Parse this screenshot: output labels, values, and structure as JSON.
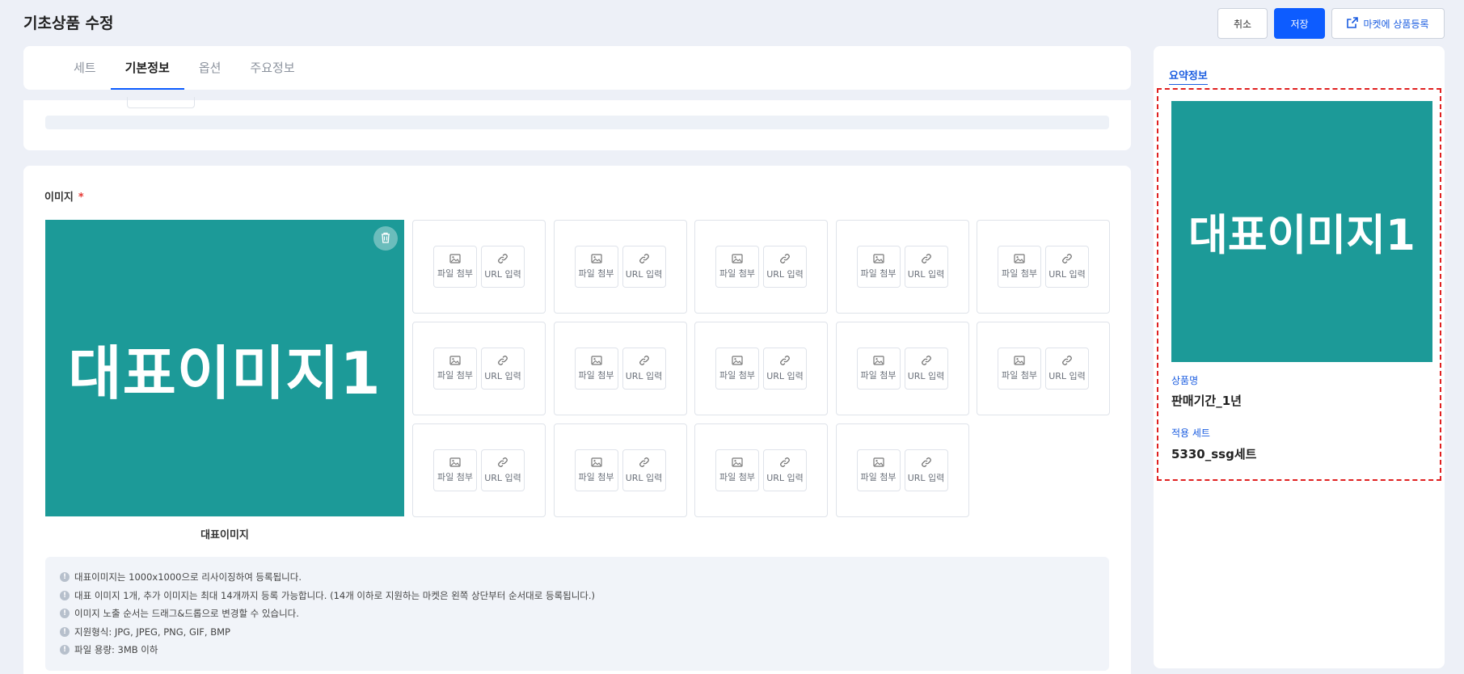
{
  "header": {
    "title": "기초상품 수정",
    "cancel_label": "취소",
    "save_label": "저장",
    "market_label": "마켓에 상품등록"
  },
  "tabs": [
    {
      "label": "세트",
      "active": false
    },
    {
      "label": "기본정보",
      "active": true
    },
    {
      "label": "옵션",
      "active": false
    },
    {
      "label": "주요정보",
      "active": false
    }
  ],
  "image_section": {
    "label": "이미지",
    "required_mark": "*",
    "main_image_text": "대표이미지1",
    "main_caption": "대표이미지",
    "slot_file_label": "파일 첨부",
    "slot_url_label": "URL 입력",
    "slot_count": 14,
    "notices": [
      "대표이미지는 1000x1000으로 리사이징하여 등록됩니다.",
      "대표 이미지 1개, 추가 이미지는 최대 14개까지 등록 가능합니다. (14개 이하로 지원하는 마켓은 왼쪽 상단부터 순서대로 등록됩니다.)",
      "이미지 노출 순서는 드래그&드롭으로 변경할 수 있습니다.",
      "지원형식: JPG, JPEG, PNG, GIF, BMP",
      "파일 용량: 3MB 이하"
    ]
  },
  "summary": {
    "title": "요약정보",
    "image_text": "대표이미지1",
    "product_name_label": "상품명",
    "product_name": "판매기간_1년",
    "set_label": "적용 세트",
    "set_value": "5330_ssg세트"
  },
  "colors": {
    "accent": "#0d5cff",
    "image_bg": "#1c9a98",
    "highlight_border": "#e02020",
    "page_bg": "#edf0f7"
  }
}
